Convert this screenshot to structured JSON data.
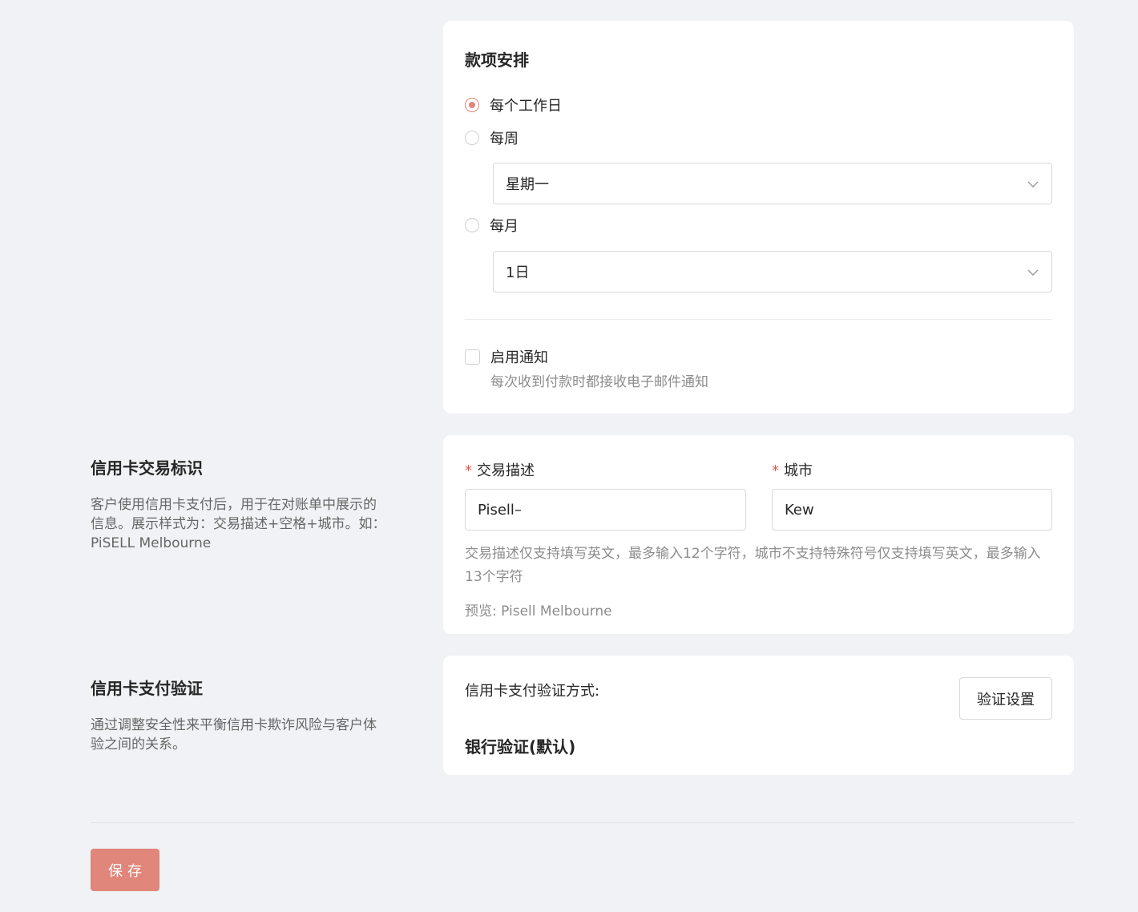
{
  "payout_schedule": {
    "title": "款项安排",
    "options": [
      {
        "label": "每个工作日",
        "checked": true
      },
      {
        "label": "每周",
        "checked": false
      },
      {
        "label": "每月",
        "checked": false
      }
    ],
    "weekly_select_value": "星期一",
    "monthly_select_value": "1日",
    "notify_label": "启用通知",
    "notify_desc": "每次收到付款时都接收电子邮件通知"
  },
  "statement": {
    "left_title": "信用卡交易标识",
    "left_desc": "客户使用信用卡支付后，用于在对账单中展示的信息。展示样式为：交易描述+空格+城市。如：PiSELL Melbourne",
    "desc_label": "交易描述",
    "desc_value": "Pisell–",
    "city_label": "城市",
    "city_value": "Kew",
    "required_mark": "*",
    "hint": "交易描述仅支持填写英文，最多输入12个字符，城市不支持特殊符号仅支持填写英文，最多输入13个字符",
    "preview": "预览: Pisell Melbourne"
  },
  "verification": {
    "left_title": "信用卡支付验证",
    "left_desc": "通过调整安全性来平衡信用卡欺诈风险与客户体验之间的关系。",
    "method_label": "信用卡支付验证方式:",
    "settings_button": "验证设置",
    "method_value": "银行验证(默认)"
  },
  "footer": {
    "save_label": "保存"
  },
  "colors": {
    "accent": "#e0867a",
    "background": "#f1f2f5",
    "required": "#e5584d"
  }
}
